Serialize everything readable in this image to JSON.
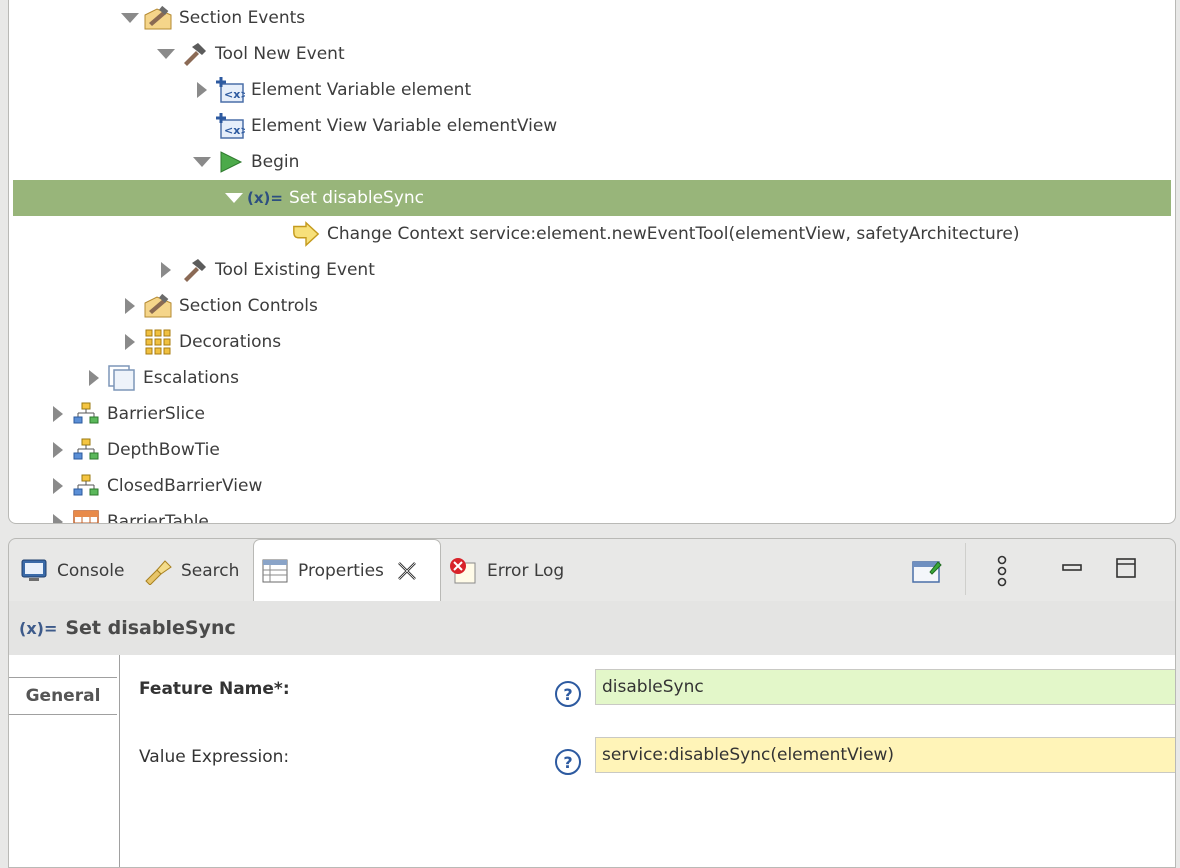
{
  "tree": {
    "rows": [
      {
        "label": "Section Events",
        "icon": "section-icon"
      },
      {
        "label": "Tool New Event",
        "icon": "hammer-icon"
      },
      {
        "label": "Element Variable element",
        "icon": "variable-icon"
      },
      {
        "label": "Element View Variable elementView",
        "icon": "variable-icon"
      },
      {
        "label": "Begin",
        "icon": "play-icon"
      },
      {
        "label": "Set disableSync",
        "icon": "set-variable-icon",
        "icon_text": "(x)="
      },
      {
        "label": "Change Context service:element.newEventTool(elementView, safetyArchitecture)",
        "icon": "change-context-icon"
      },
      {
        "label": "Tool Existing Event",
        "icon": "hammer-icon"
      },
      {
        "label": "Section Controls",
        "icon": "section-icon"
      },
      {
        "label": "Decorations",
        "icon": "grid-icon"
      },
      {
        "label": "Escalations",
        "icon": "layers-icon"
      },
      {
        "label": "BarrierSlice",
        "icon": "diagram-icon"
      },
      {
        "label": "DepthBowTie",
        "icon": "diagram-icon"
      },
      {
        "label": "ClosedBarrierView",
        "icon": "diagram-icon"
      },
      {
        "label": "BarrierTable",
        "icon": "table-icon"
      }
    ]
  },
  "tabs": [
    {
      "label": "Console",
      "icon": "console-icon"
    },
    {
      "label": "Search",
      "icon": "flashlight-icon"
    },
    {
      "label": "Properties",
      "icon": "properties-icon"
    },
    {
      "label": "Error Log",
      "icon": "error-log-icon"
    }
  ],
  "properties": {
    "header_icon_text": "(x)=",
    "header_title": "Set disableSync",
    "side_tab": "General",
    "fields": [
      {
        "label": "Feature Name*:",
        "value": "disableSync",
        "color": "#e3f7c9"
      },
      {
        "label": "Value Expression:",
        "value": "service:disableSync(elementView)",
        "color": "#fff4b8"
      }
    ]
  },
  "colors": {
    "selection": "#98b57a",
    "help": "#2d5aa0"
  }
}
